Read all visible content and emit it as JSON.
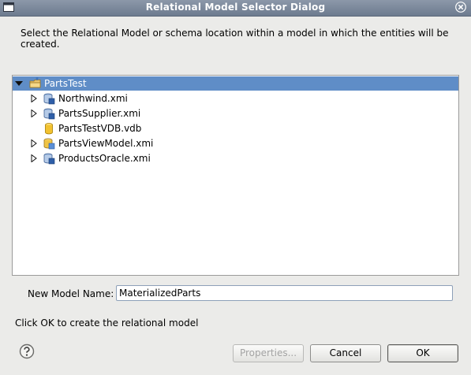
{
  "window": {
    "title": "Relational Model Selector Dialog"
  },
  "instruction": "Select the Relational Model or schema location within a model in which the entities will be created.",
  "tree": {
    "root": {
      "label": "PartsTest",
      "icon": "project-folder-icon",
      "expanded": true,
      "selected": true
    },
    "children": [
      {
        "label": "Northwind.xmi",
        "icon": "relational-model-icon",
        "expandable": true
      },
      {
        "label": "PartsSupplier.xmi",
        "icon": "relational-model-icon",
        "expandable": true
      },
      {
        "label": "PartsTestVDB.vdb",
        "icon": "vdb-icon",
        "expandable": false
      },
      {
        "label": "PartsViewModel.xmi",
        "icon": "view-model-icon",
        "expandable": true
      },
      {
        "label": "ProductsOracle.xmi",
        "icon": "relational-model-icon",
        "expandable": true
      }
    ]
  },
  "form": {
    "model_name_label": "New Model Name:",
    "model_name_value": "MaterializedParts"
  },
  "hint": "Click OK to create the relational model",
  "buttons": {
    "properties": "Properties...",
    "cancel": "Cancel",
    "ok": "OK"
  }
}
